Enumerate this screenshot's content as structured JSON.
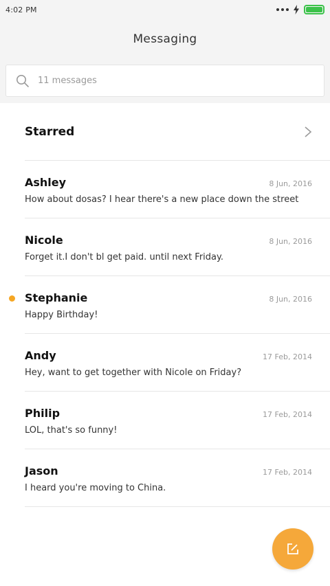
{
  "status": {
    "time": "4:02 PM",
    "battery_color": "#3cc24a"
  },
  "header": {
    "title": "Messaging"
  },
  "search": {
    "placeholder": "11 messages"
  },
  "starred": {
    "label": "Starred"
  },
  "messages": [
    {
      "name": "Ashley",
      "date": "8 Jun, 2016",
      "preview": "How about dosas? I hear there's a new place down the street",
      "unread": false
    },
    {
      "name": "Nicole",
      "date": "8 Jun, 2016",
      "preview": "Forget it.I don't bl get paid. until next Friday.",
      "unread": false
    },
    {
      "name": "Stephanie",
      "date": "8 Jun, 2016",
      "preview": "Happy Birthday!",
      "unread": true
    },
    {
      "name": "Andy",
      "date": "17 Feb, 2014",
      "preview": "Hey, want to get together with Nicole on Friday?",
      "unread": false
    },
    {
      "name": "Philip",
      "date": "17 Feb, 2014",
      "preview": "LOL, that's so funny!",
      "unread": false
    },
    {
      "name": "Jason",
      "date": "17 Feb, 2014",
      "preview": "I heard you're moving to China.",
      "unread": false
    }
  ],
  "colors": {
    "accent": "#f5a623",
    "fab": "#f5a83a"
  },
  "icons": {
    "search": "search-icon",
    "chevron": "chevron-right-icon",
    "compose": "compose-icon"
  }
}
